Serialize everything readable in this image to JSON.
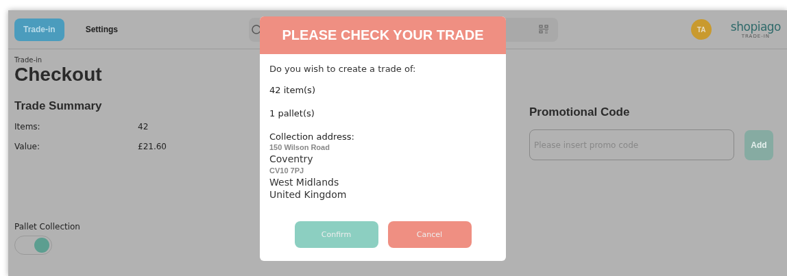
{
  "nav": {
    "tabs": [
      {
        "label": "Trade-in",
        "selected": true
      },
      {
        "label": "Settings",
        "selected": false
      }
    ]
  },
  "user": {
    "initials": "TA"
  },
  "logo": {
    "name": "shopiago",
    "tagline": "TRADE-IN"
  },
  "breadcrumb": "Trade-in",
  "page_title": "Checkout",
  "trade_summary": {
    "title": "Trade Summary",
    "rows": [
      {
        "label": "Items:",
        "value": "42"
      },
      {
        "label": "Value:",
        "value": "£21.60"
      }
    ]
  },
  "pallet_collection": {
    "label": "Pallet Collection",
    "on": true
  },
  "promo": {
    "title": "Promotional Code",
    "placeholder": "Please insert promo code",
    "button": "Add",
    "disabled": true
  },
  "dialog": {
    "title": "PLEASE CHECK YOUR TRADE",
    "question": "Do you wish to create a trade of:",
    "items": "42 item(s)",
    "pallets": "1 pallet(s)",
    "address_label": "Collection address:",
    "address_lines": [
      {
        "text": "150 Wilson Road",
        "kind": "small"
      },
      {
        "text": "Coventry",
        "kind": "normal"
      },
      {
        "text": "CV10 7PJ",
        "kind": "small"
      },
      {
        "text": "West Midlands",
        "kind": "normal"
      },
      {
        "text": "United Kingdom",
        "kind": "normal"
      }
    ],
    "confirm": "Confirm",
    "cancel": "Cancel"
  }
}
